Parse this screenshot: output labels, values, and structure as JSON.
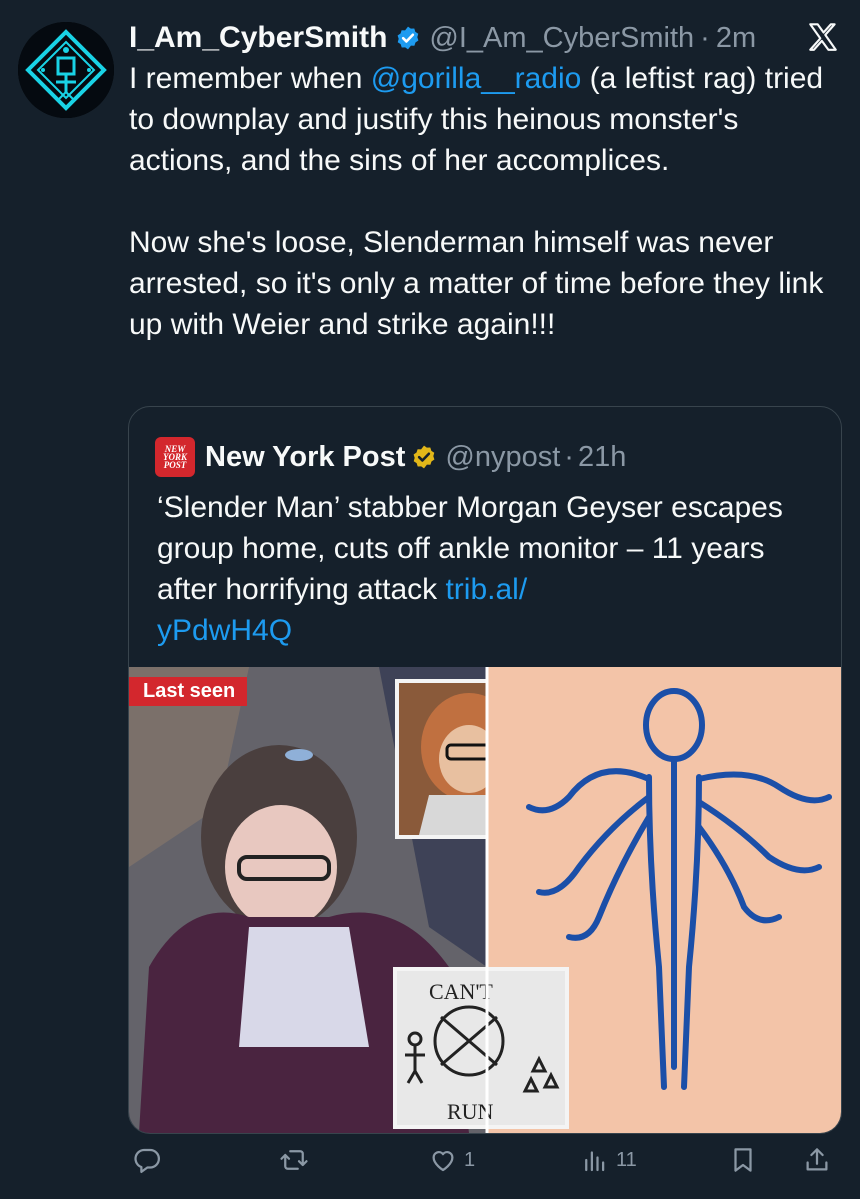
{
  "tweet": {
    "display_name": "I_Am_CyberSmith",
    "handle": "@I_Am_CyberSmith",
    "separator": "·",
    "time": "2m",
    "text_intro": "I remember when ",
    "mention": "@gorilla__radio",
    "text_rest": " (a leftist rag) tried to downplay and justify this heinous monster's actions, and the sins of her accomplices.",
    "paragraph2": "Now she's loose, Slenderman himself was never arrested, so it's only a matter of time before they link up with Weier and strike again!!!"
  },
  "quote": {
    "logo_lines": [
      "NEW",
      "YORK",
      "POST"
    ],
    "display_name": "New York Post",
    "handle": "@nypost",
    "separator": "·",
    "time": "21h",
    "text": "‘Slender Man’ stabber Morgan Geyser escapes group home, cuts off ankle monitor – 11 years after horrifying attack ",
    "link_part1": "trib.al/",
    "link_part2": "yPdwH4Q",
    "media": {
      "badge": "Last seen",
      "drawing_text_top": "CAN'T",
      "drawing_text_bottom": "RUN"
    }
  },
  "actions": {
    "reply_icon": "reply-icon",
    "retweet_icon": "retweet-icon",
    "like_icon": "heart-icon",
    "like_count": "1",
    "views_icon": "views-icon",
    "views_count": "11",
    "bookmark_icon": "bookmark-icon",
    "share_icon": "share-icon"
  },
  "colors": {
    "background": "#15202b",
    "text": "#f7f9f9",
    "secondary": "#8b98a5",
    "link": "#1d9bf0",
    "verified_blue": "#1d9bf0",
    "verified_gold": "#e2b719",
    "nyp_red": "#d3272d"
  }
}
